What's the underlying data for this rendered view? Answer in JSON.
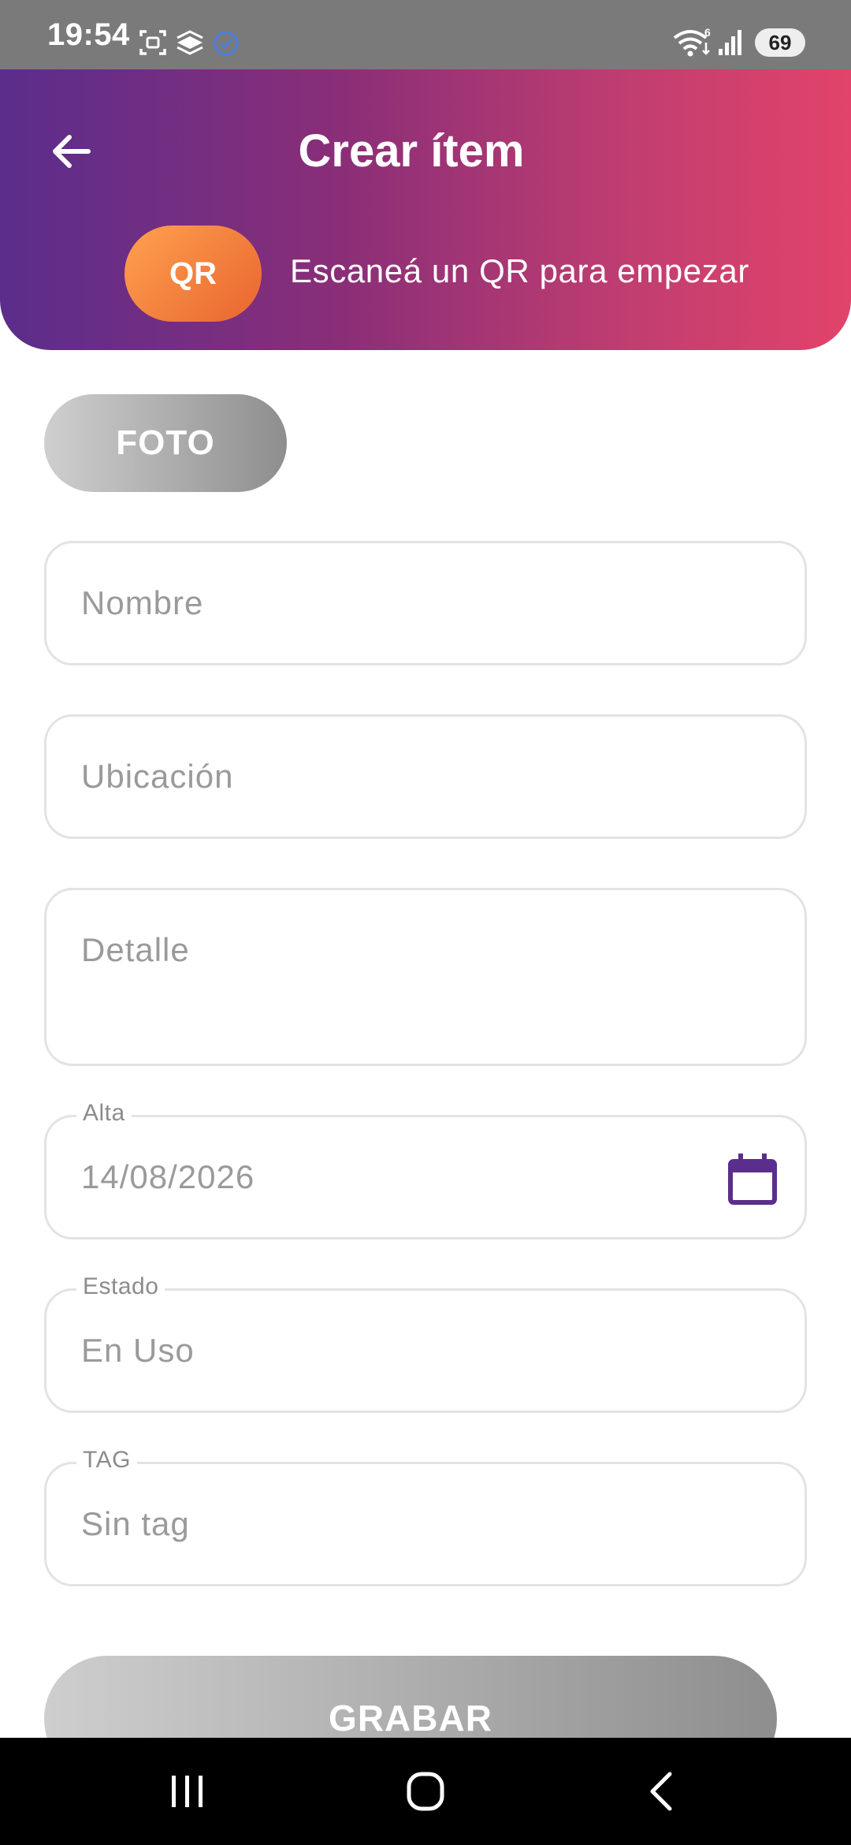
{
  "status_bar": {
    "time": "19:54",
    "battery": "69"
  },
  "header": {
    "title": "Crear ítem",
    "qr_button_label": "QR",
    "qr_hint": "Escaneá un QR para empezar",
    "gradient_colors": [
      "#5b2d8c",
      "#e2436a"
    ]
  },
  "foto_button_label": "FOTO",
  "form": {
    "nombre": {
      "placeholder": "Nombre",
      "value": ""
    },
    "ubicacion": {
      "placeholder": "Ubicación",
      "value": ""
    },
    "detalle": {
      "placeholder": "Detalle",
      "value": ""
    },
    "alta": {
      "label": "Alta",
      "value": "14/08/2026",
      "icon": "calendar-icon"
    },
    "estado": {
      "label": "Estado",
      "value": "En Uso"
    },
    "tag": {
      "label": "TAG",
      "value": "Sin tag"
    }
  },
  "grabar_button_label": "GRABAR",
  "accent_color": "#5b2d8c",
  "nav_bar": {
    "icons": [
      "recent-apps-icon",
      "home-icon",
      "back-icon"
    ]
  }
}
